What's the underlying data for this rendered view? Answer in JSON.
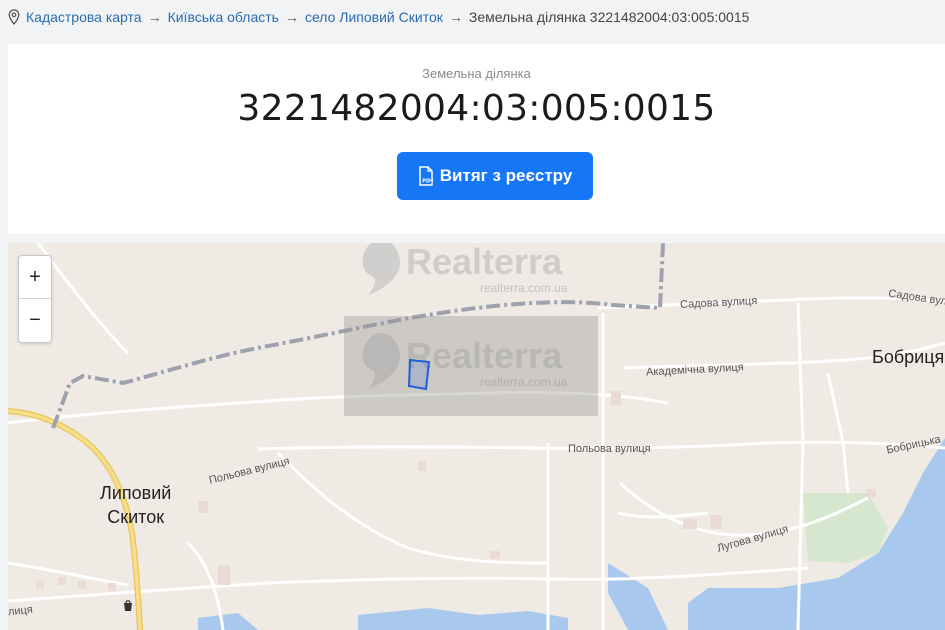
{
  "breadcrumb": {
    "items": [
      "Кадастрова карта",
      "Київська область",
      "село Липовий Скиток"
    ],
    "separator": "→",
    "current": "Земельна ділянка 3221482004:03:005:0015"
  },
  "header": {
    "subtitle": "Земельна ділянка",
    "title": "3221482004:03:005:0015",
    "button_label": "Витяг з реєстру"
  },
  "map": {
    "zoom_in": "+",
    "zoom_out": "−",
    "watermark_brand": "Realterra",
    "watermark_url": "realterra.com.ua",
    "streets": {
      "sadova_1": "Садова вулиця",
      "sadova_2": "Садова вулиця",
      "akademichna": "Академічна вулиця",
      "polova_1": "Польова вулиця",
      "polova_2": "Польова вулиця",
      "bobrytska": "Бобрицька",
      "luhova": "Лугова вулиця",
      "partial_left": "лиця"
    },
    "towns": {
      "lypovyi_line1": "Липовий",
      "lypovyi_line2": "Скиток",
      "bobrytsia": "Бобриця"
    }
  },
  "colors": {
    "link": "#2b6cb0",
    "button": "#1677f6",
    "parcel": "#1f5fd6",
    "water": "#a9c8ee",
    "road_major": "#f3d36b"
  }
}
